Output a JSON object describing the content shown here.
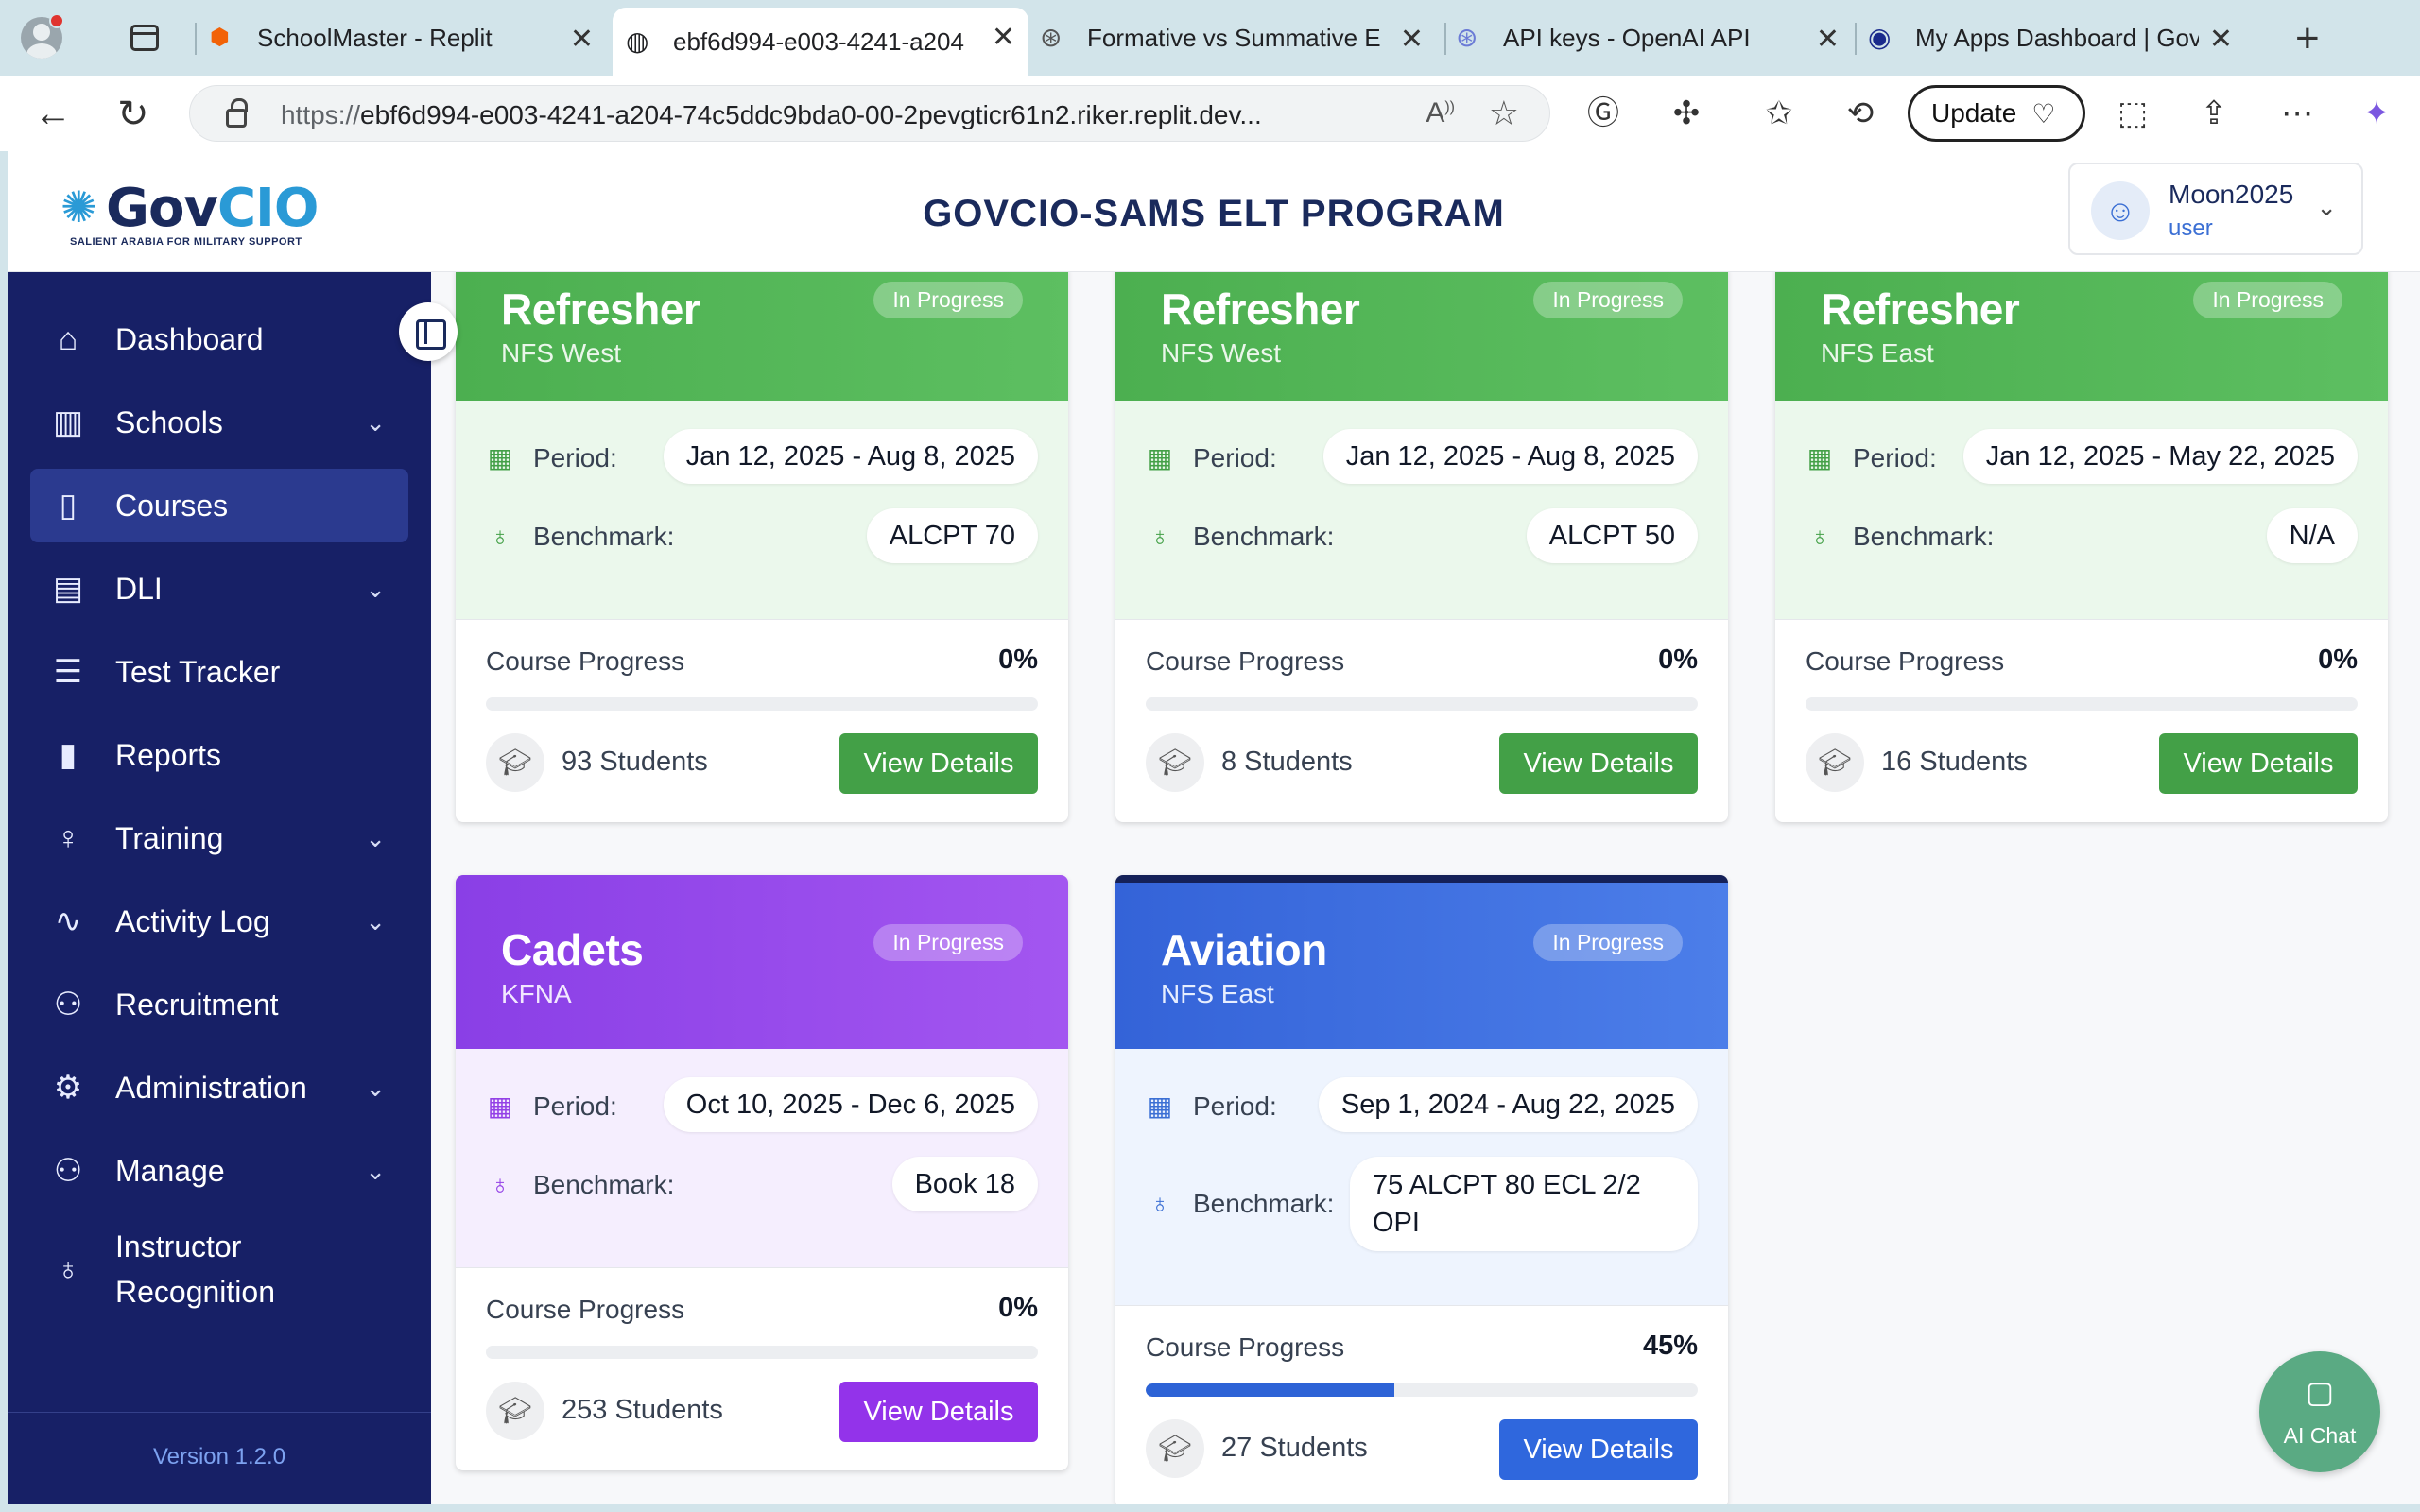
{
  "browser": {
    "tabs": [
      {
        "title": "SchoolMaster - Replit"
      },
      {
        "title": "ebf6d994-e003-4241-a204"
      },
      {
        "title": "Formative vs Summative Eva"
      },
      {
        "title": "API keys - OpenAI API"
      },
      {
        "title": "My Apps Dashboard | GovCI"
      }
    ],
    "url_proto": "https://",
    "url_rest": "ebf6d994-e003-4241-a204-74c5ddc9bda0-00-2pevgticr61n2.riker.replit.dev...",
    "update_label": "Update"
  },
  "header": {
    "logo_brand_gov": "Gov",
    "logo_brand_cio": "CIO",
    "logo_tagline": "SALIENT ARABIA FOR MILITARY SUPPORT",
    "title": "GOVCIO-SAMS ELT PROGRAM",
    "user": {
      "name": "Moon2025",
      "role": "user"
    }
  },
  "sidebar": {
    "items": [
      {
        "label": "Dashboard",
        "icon": "home-icon"
      },
      {
        "label": "Schools",
        "icon": "building-icon",
        "expandable": true
      },
      {
        "label": "Courses",
        "icon": "book-open-icon",
        "active": true
      },
      {
        "label": "DLI",
        "icon": "document-icon",
        "expandable": true
      },
      {
        "label": "Test Tracker",
        "icon": "checklist-icon"
      },
      {
        "label": "Reports",
        "icon": "bar-chart-icon"
      },
      {
        "label": "Training",
        "icon": "lightbulb-icon",
        "expandable": true
      },
      {
        "label": "Activity Log",
        "icon": "activity-icon",
        "expandable": true
      },
      {
        "label": "Recruitment",
        "icon": "users-icon"
      },
      {
        "label": "Administration",
        "icon": "settings-icon",
        "expandable": true
      },
      {
        "label": "Manage",
        "icon": "users-icon",
        "expandable": true
      },
      {
        "label_line1": "Instructor",
        "label_line2": "Recognition",
        "icon": "award-icon"
      }
    ],
    "version": "Version 1.2.0"
  },
  "labels": {
    "period": "Period:",
    "benchmark": "Benchmark:",
    "course_progress": "Course Progress",
    "view_details": "View Details"
  },
  "courses": [
    {
      "title": "Refresher",
      "location": "NFS West",
      "status": "In Progress",
      "period": "Jan 12, 2025 - Aug 8, 2025",
      "benchmark": "ALCPT 70",
      "progress_text": "0%",
      "progress": 0,
      "students": "93 Students",
      "theme": "green"
    },
    {
      "title": "Refresher",
      "location": "NFS West",
      "status": "In Progress",
      "period": "Jan 12, 2025 - Aug 8, 2025",
      "benchmark": "ALCPT 50",
      "progress_text": "0%",
      "progress": 0,
      "students": "8 Students",
      "theme": "green"
    },
    {
      "title": "Refresher",
      "location": "NFS East",
      "status": "In Progress",
      "period": "Jan 12, 2025 - May 22, 2025",
      "benchmark": "N/A",
      "progress_text": "0%",
      "progress": 0,
      "students": "16 Students",
      "theme": "green"
    },
    {
      "title": "Cadets",
      "location": "KFNA",
      "status": "In Progress",
      "period": "Oct 10, 2025 - Dec 6, 2025",
      "benchmark": "Book 18",
      "progress_text": "0%",
      "progress": 0,
      "students": "253 Students",
      "theme": "purple"
    },
    {
      "title": "Aviation",
      "location": "NFS East",
      "status": "In Progress",
      "period": "Sep 1, 2024 - Aug 22, 2025",
      "benchmark": "75 ALCPT 80 ECL 2/2 OPI",
      "progress_text": "45%",
      "progress": 45,
      "students": "27 Students",
      "theme": "blue"
    }
  ],
  "ai_chat": {
    "label": "AI Chat"
  }
}
